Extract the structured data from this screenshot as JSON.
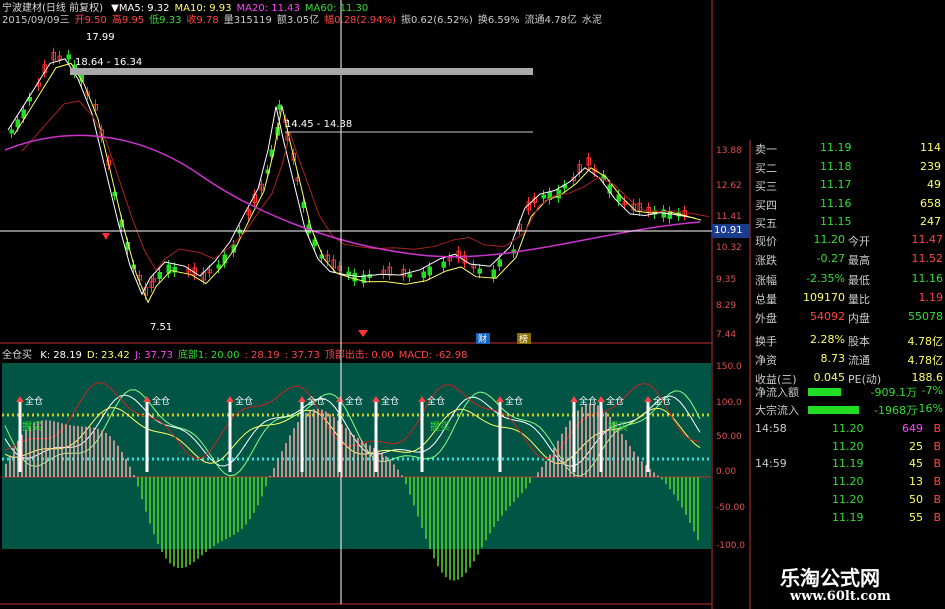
{
  "header": {
    "title": "宁波建材(日线 前复权)",
    "items": [
      {
        "t": "▼MA5: 9.32",
        "c": "#ffffff"
      },
      {
        "t": "MA10: 9.93",
        "c": "#ffff66"
      },
      {
        "t": "MA20: 11.43",
        "c": "#ff44ff"
      },
      {
        "t": "MA60: 11.30",
        "c": "#33dd33"
      }
    ],
    "line2": [
      {
        "t": "2015/09/09三",
        "c": "#cccccc"
      },
      {
        "t": "开9.50",
        "c": "#ff4444"
      },
      {
        "t": "高9.95",
        "c": "#ff4444"
      },
      {
        "t": "低9.33",
        "c": "#33dd33"
      },
      {
        "t": "收9.78",
        "c": "#ff4444"
      },
      {
        "t": "量315119",
        "c": "#cccccc"
      },
      {
        "t": "额3.05亿",
        "c": "#cccccc"
      },
      {
        "t": "幅0.28(2.94%)",
        "c": "#ff4444"
      },
      {
        "t": "振0.62(6.52%)",
        "c": "#cccccc"
      },
      {
        "t": "换6.59%",
        "c": "#cccccc"
      },
      {
        "t": "流通4.78亿",
        "c": "#cccccc"
      },
      {
        "t": "水泥",
        "c": "#cccccc"
      }
    ]
  },
  "price_axis": [
    "13.88",
    "12.62",
    "11.41",
    "10.32",
    "9.35",
    "8.29",
    "7.44"
  ],
  "current_price": "10.91",
  "price_marks": {
    "high": "17.99",
    "low": "7.51",
    "range1": "18.64 - 16.34",
    "range2": "14.45 - 14.38"
  },
  "volume_markers": [
    "财",
    "榜"
  ],
  "indicator": {
    "name": "全仓买",
    "line": [
      {
        "t": "K: 28.19",
        "c": "#ffffff"
      },
      {
        "t": "D: 23.42",
        "c": "#ffff66"
      },
      {
        "t": "J: 37.73",
        "c": "#ff44ff"
      },
      {
        "t": "底部1: 20.00",
        "c": "#33dd33"
      },
      {
        "t": ": 28.19",
        "c": "#ff4444"
      },
      {
        "t": ": 37.73",
        "c": "#ff4444"
      },
      {
        "t": "顶部出击: 0.00",
        "c": "#ff4444"
      },
      {
        "t": "MACD: -62.98",
        "c": "#ff4444"
      }
    ],
    "axis": [
      "150.0",
      "100.0",
      "50.00",
      "0.00",
      "-50.00",
      "-100.0"
    ],
    "signal_label": "全仓",
    "buy_label": "握买"
  },
  "quote": {
    "asks": [
      {
        "label": "卖一",
        "price": "11.19",
        "vol": "114"
      },
      {
        "label": "买二",
        "price": "11.18",
        "vol": "239"
      },
      {
        "label": "买三",
        "price": "11.17",
        "vol": "49"
      },
      {
        "label": "买四",
        "price": "11.16",
        "vol": "658"
      },
      {
        "label": "买五",
        "price": "11.15",
        "vol": "247"
      }
    ],
    "stats": [
      {
        "l1": "现价",
        "v1": "11.20",
        "c1": "#33dd33",
        "l2": "今开",
        "v2": "11.47",
        "c2": "#ff4444"
      },
      {
        "l1": "涨跌",
        "v1": "-0.27",
        "c1": "#33dd33",
        "l2": "最高",
        "v2": "11.52",
        "c2": "#ff4444"
      },
      {
        "l1": "涨幅",
        "v1": "-2.35%",
        "c1": "#33dd33",
        "l2": "最低",
        "v2": "11.16",
        "c2": "#33dd33"
      },
      {
        "l1": "总量",
        "v1": "109170",
        "c1": "#ffff66",
        "l2": "量比",
        "v2": "1.19",
        "c2": "#ff4444"
      },
      {
        "l1": "外盘",
        "v1": "54092",
        "c1": "#ff4444",
        "l2": "内盘",
        "v2": "55078",
        "c2": "#33dd33"
      },
      {
        "l1": "换手",
        "v1": "2.28%",
        "c1": "#ffff66",
        "l2": "股本",
        "v2": "4.78亿",
        "c2": "#ffff66"
      },
      {
        "l1": "净资",
        "v1": "8.73",
        "c1": "#ffff66",
        "l2": "流通",
        "v2": "4.78亿",
        "c2": "#ffff66"
      },
      {
        "l1": "收益(三)",
        "v1": "0.045",
        "c1": "#ffff66",
        "l2": "PE(动)",
        "v2": "188.6",
        "c2": "#ffff66"
      }
    ],
    "flows": [
      {
        "label": "净流入额",
        "value": "-909.1万",
        "pct": "-7%",
        "bar": 0.55
      },
      {
        "label": "大宗流入",
        "value": "-1968万",
        "pct": "-16%",
        "bar": 0.85
      }
    ]
  },
  "ticks": [
    {
      "time": "14:58",
      "price": "11.20",
      "vol": "649",
      "bs": "B",
      "vc": "#ff44ff"
    },
    {
      "time": "",
      "price": "11.20",
      "vol": "25",
      "bs": "B",
      "vc": "#ffff66"
    },
    {
      "time": "14:59",
      "price": "11.19",
      "vol": "45",
      "bs": "B",
      "vc": "#ffff66"
    },
    {
      "time": "",
      "price": "11.20",
      "vol": "13",
      "bs": "B",
      "vc": "#ffff66"
    },
    {
      "time": "",
      "price": "11.20",
      "vol": "50",
      "bs": "B",
      "vc": "#ffff66"
    },
    {
      "time": "",
      "price": "11.19",
      "vol": "55",
      "bs": "B",
      "vc": "#ffff66"
    }
  ],
  "watermark": {
    "line1": "乐淘公式网",
    "line2": "www.60lt.com"
  },
  "colors": {
    "up": "#ff3333",
    "down": "#22dd22",
    "panel": "#005545",
    "axis": "#c03030"
  }
}
